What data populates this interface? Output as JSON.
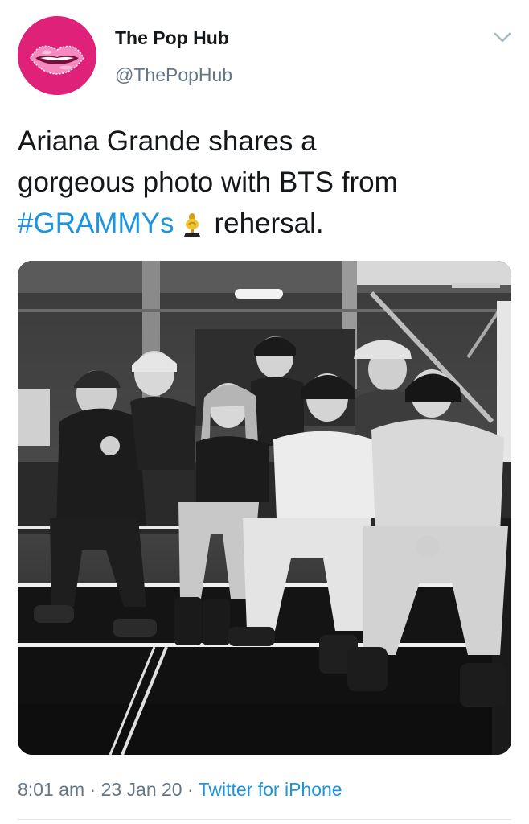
{
  "author": {
    "display_name": "The Pop Hub",
    "handle": "@ThePopHub",
    "avatar_icon": "lips-icon",
    "avatar_color": "#e0217a"
  },
  "menu": {
    "icon": "chevron-down-icon"
  },
  "tweet": {
    "line1": "Ariana Grande shares a",
    "line2": "gorgeous photo with BTS from",
    "hashtag": "#GRAMMYs",
    "emoji_icon": "grammy-trophy-icon",
    "line3_rest": "rehersal."
  },
  "media": {
    "type": "black-and-white photo"
  },
  "meta": {
    "time": "8:01 am",
    "separator1": " · ",
    "date": "23 Jan 20",
    "separator2": " · ",
    "source": "Twitter for iPhone"
  },
  "colors": {
    "link": "#1b95e0",
    "text": "#14171a",
    "muted": "#657786"
  }
}
